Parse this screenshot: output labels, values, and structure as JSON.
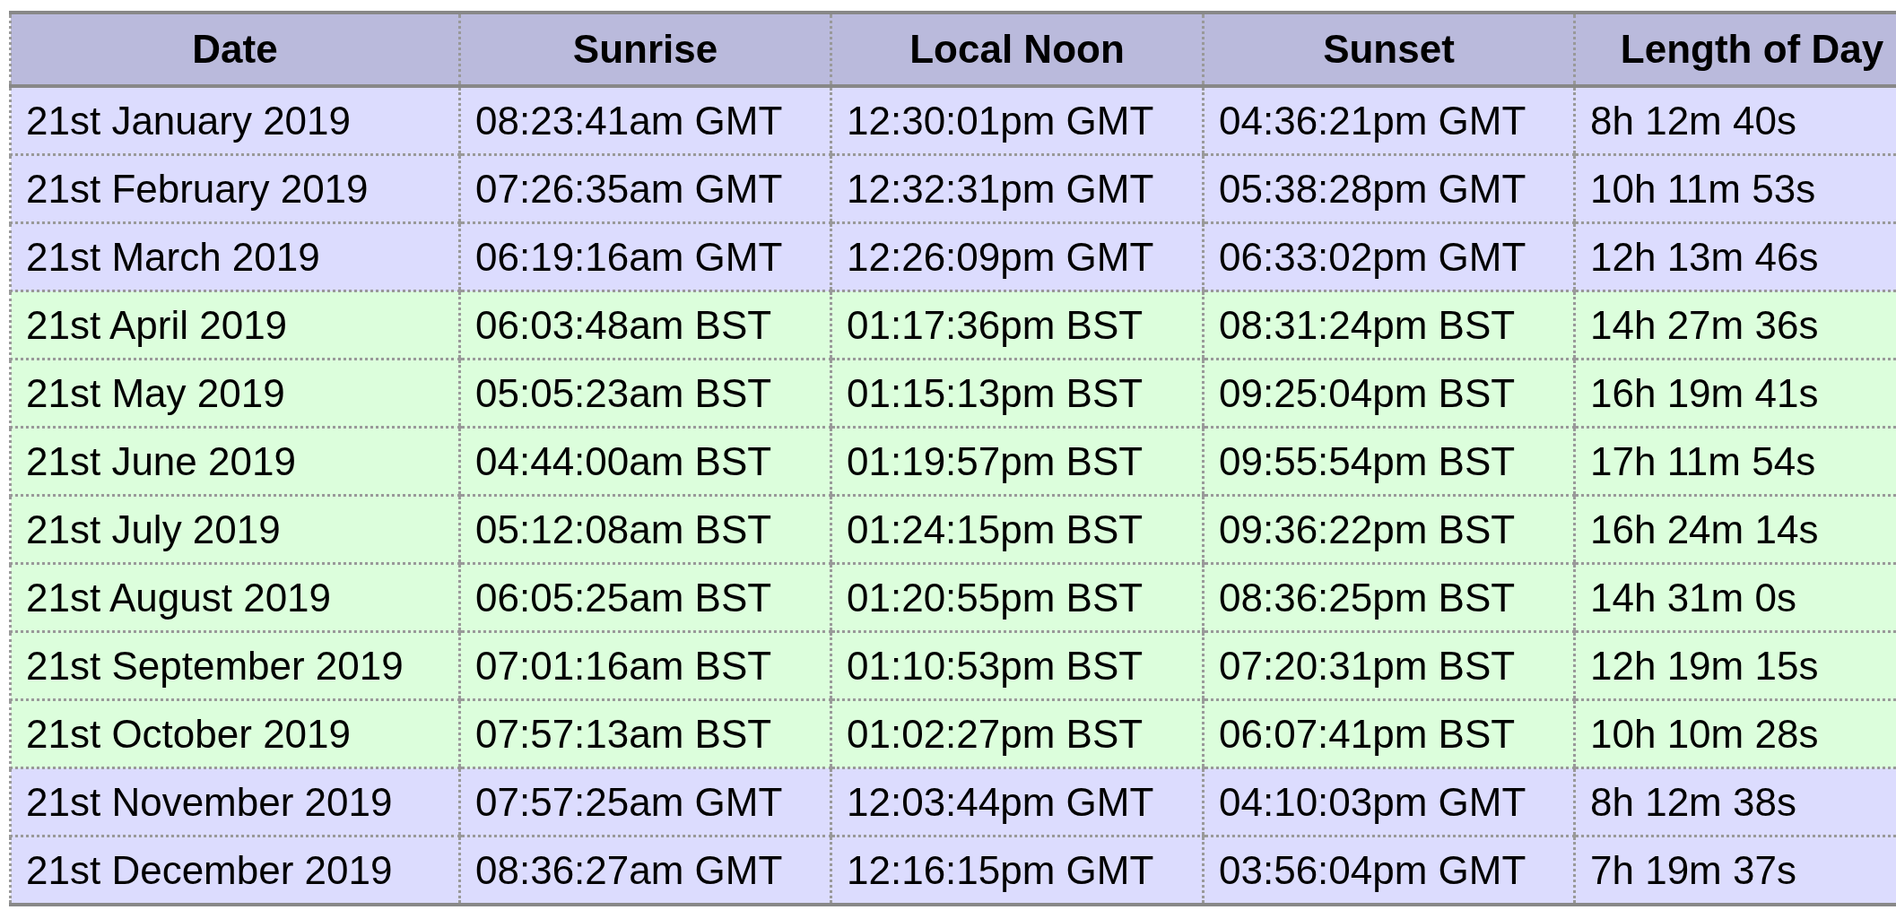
{
  "table": {
    "columns": [
      "Date",
      "Sunrise",
      "Local Noon",
      "Sunset",
      "Length of Day"
    ],
    "rows": [
      {
        "color": "#dcdcfe",
        "cells": [
          "21st January 2019",
          "08:23:41am GMT",
          "12:30:01pm GMT",
          "04:36:21pm GMT",
          "8h 12m 40s"
        ]
      },
      {
        "color": "#dcdcfe",
        "cells": [
          "21st February 2019",
          "07:26:35am GMT",
          "12:32:31pm GMT",
          "05:38:28pm GMT",
          "10h 11m 53s"
        ]
      },
      {
        "color": "#dcdcfe",
        "cells": [
          "21st March 2019",
          "06:19:16am GMT",
          "12:26:09pm GMT",
          "06:33:02pm GMT",
          "12h 13m 46s"
        ]
      },
      {
        "color": "#dcfedc",
        "cells": [
          "21st April 2019",
          "06:03:48am BST",
          "01:17:36pm BST",
          "08:31:24pm BST",
          "14h 27m 36s"
        ]
      },
      {
        "color": "#dcfedc",
        "cells": [
          "21st May 2019",
          "05:05:23am BST",
          "01:15:13pm BST",
          "09:25:04pm BST",
          "16h 19m 41s"
        ]
      },
      {
        "color": "#dcfedc",
        "cells": [
          "21st June 2019",
          "04:44:00am BST",
          "01:19:57pm BST",
          "09:55:54pm BST",
          "17h 11m 54s"
        ]
      },
      {
        "color": "#dcfedc",
        "cells": [
          "21st July 2019",
          "05:12:08am BST",
          "01:24:15pm BST",
          "09:36:22pm BST",
          "16h 24m 14s"
        ]
      },
      {
        "color": "#dcfedc",
        "cells": [
          "21st August 2019",
          "06:05:25am BST",
          "01:20:55pm BST",
          "08:36:25pm BST",
          "14h 31m 0s"
        ]
      },
      {
        "color": "#dcfedc",
        "cells": [
          "21st September 2019",
          "07:01:16am BST",
          "01:10:53pm BST",
          "07:20:31pm BST",
          "12h 19m 15s"
        ]
      },
      {
        "color": "#dcfedc",
        "cells": [
          "21st October 2019",
          "07:57:13am BST",
          "01:02:27pm BST",
          "06:07:41pm BST",
          "10h 10m 28s"
        ]
      },
      {
        "color": "#dcdcfe",
        "cells": [
          "21st November 2019",
          "07:57:25am GMT",
          "12:03:44pm GMT",
          "04:10:03pm GMT",
          "8h 12m 38s"
        ]
      },
      {
        "color": "#dcdcfe",
        "cells": [
          "21st December 2019",
          "08:36:27am GMT",
          "12:16:15pm GMT",
          "03:56:04pm GMT",
          "7h 19m 37s"
        ]
      }
    ]
  }
}
